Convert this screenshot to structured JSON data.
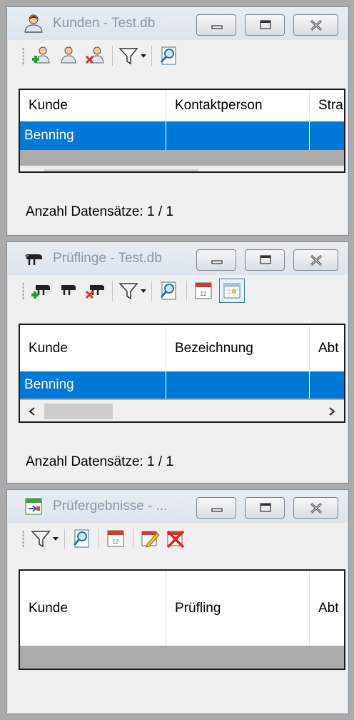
{
  "windows": [
    {
      "title": "Kunden - Test.db",
      "icon": "customer-person-icon",
      "toolbar": [
        "add-customer-icon",
        "edit-customer-icon",
        "delete-customer-icon",
        "filter-dropdown-icon",
        "search-preview-icon"
      ],
      "columns": [
        "Kunde",
        "Kontaktperson",
        "Stra"
      ],
      "rows": [
        [
          "Benning",
          "",
          ""
        ]
      ],
      "status": "Anzahl Datensätze: 1 / 1"
    },
    {
      "title": "Prüflinge - Test.db",
      "icon": "device-plug-icon",
      "toolbar": [
        "add-device-icon",
        "edit-device-icon",
        "delete-device-icon",
        "filter-dropdown-icon",
        "search-preview-icon",
        "calendar-icon",
        "table-view-icon"
      ],
      "columns": [
        "Kunde",
        "Bezeichnung",
        "Abt"
      ],
      "rows": [
        [
          "Benning",
          "",
          ""
        ]
      ],
      "status": "Anzahl Datensätze: 1 / 1"
    },
    {
      "title": "Prüfergebnisse - ...",
      "icon": "test-results-icon",
      "toolbar": [
        "filter-dropdown-icon",
        "search-preview-icon",
        "calendar-icon",
        "edit-result-icon",
        "delete-result-icon"
      ],
      "columns": [
        "Kunde",
        "Prüfling",
        "Abt"
      ],
      "rows": [],
      "status": ""
    }
  ],
  "colors": {
    "selection": "#0078d7",
    "background": "#ababab",
    "window": "#f0f0f0"
  }
}
